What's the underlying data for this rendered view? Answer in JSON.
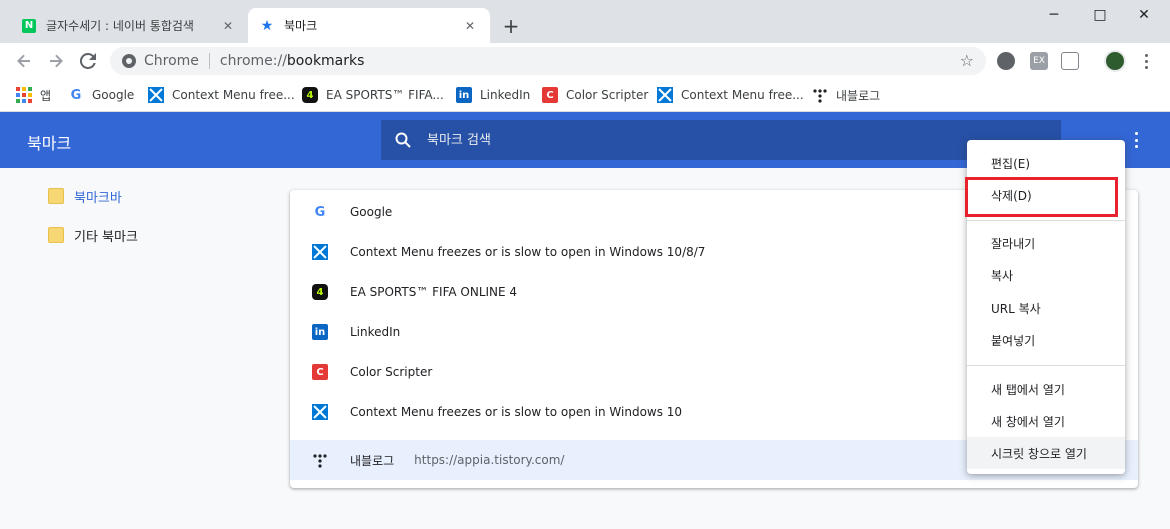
{
  "tabs": [
    {
      "title": "글자수세기 : 네이버 통합검색",
      "favicon": "naver-icon",
      "active": false
    },
    {
      "title": "북마크",
      "favicon": "bookmark-star-icon",
      "active": true
    }
  ],
  "window_controls": {
    "minimize": "─",
    "maximize": "□",
    "close": "✕"
  },
  "omnibox": {
    "scheme_label": "Chrome",
    "url_prefix": "chrome://",
    "url_path": "bookmarks"
  },
  "bookmarks_bar": [
    {
      "label": "앱",
      "icon": "apps-icon"
    },
    {
      "label": "Google",
      "icon": "google-icon"
    },
    {
      "label": "Context Menu free...",
      "icon": "windows-icon"
    },
    {
      "label": "EA SPORTS™ FIFA...",
      "icon": "fifa-icon"
    },
    {
      "label": "LinkedIn",
      "icon": "linkedin-icon"
    },
    {
      "label": "Color Scripter",
      "icon": "color-scripter-icon"
    },
    {
      "label": "Context Menu free...",
      "icon": "windows-icon"
    },
    {
      "label": "내블로그",
      "icon": "tistory-icon"
    }
  ],
  "page": {
    "title": "북마크",
    "search_placeholder": "북마크 검색"
  },
  "folders": [
    {
      "label": "북마크바",
      "selected": true
    },
    {
      "label": "기타 북마크",
      "selected": false
    }
  ],
  "bookmark_list": [
    {
      "title": "Google",
      "url": "",
      "icon": "google-icon"
    },
    {
      "title": "Context Menu freezes or is slow to open in Windows 10/8/7",
      "url": "",
      "icon": "windows-icon"
    },
    {
      "title": "EA SPORTS™ FIFA ONLINE 4",
      "url": "",
      "icon": "fifa-icon"
    },
    {
      "title": "LinkedIn",
      "url": "",
      "icon": "linkedin-icon"
    },
    {
      "title": "Color Scripter",
      "url": "",
      "icon": "color-scripter-icon"
    },
    {
      "title": "Context Menu freezes or is slow to open in Windows 10",
      "url": "",
      "icon": "windows-icon"
    },
    {
      "title": "내블로그",
      "url": "https://appia.tistory.com/",
      "icon": "tistory-icon",
      "highlighted": true
    }
  ],
  "context_menu": {
    "edit": "편집(E)",
    "delete": "삭제(D)",
    "cut": "잘라내기",
    "copy": "복사",
    "copy_url": "URL 복사",
    "paste": "붙여넣기",
    "open_new_tab": "새 탭에서 열기",
    "open_new_window": "새 창에서 열기",
    "open_incognito": "시크릿 창으로 열기"
  },
  "colors": {
    "header_blue": "#3367d6",
    "highlight_red": "#e8212e",
    "selected_row": "#e8f0fe"
  }
}
